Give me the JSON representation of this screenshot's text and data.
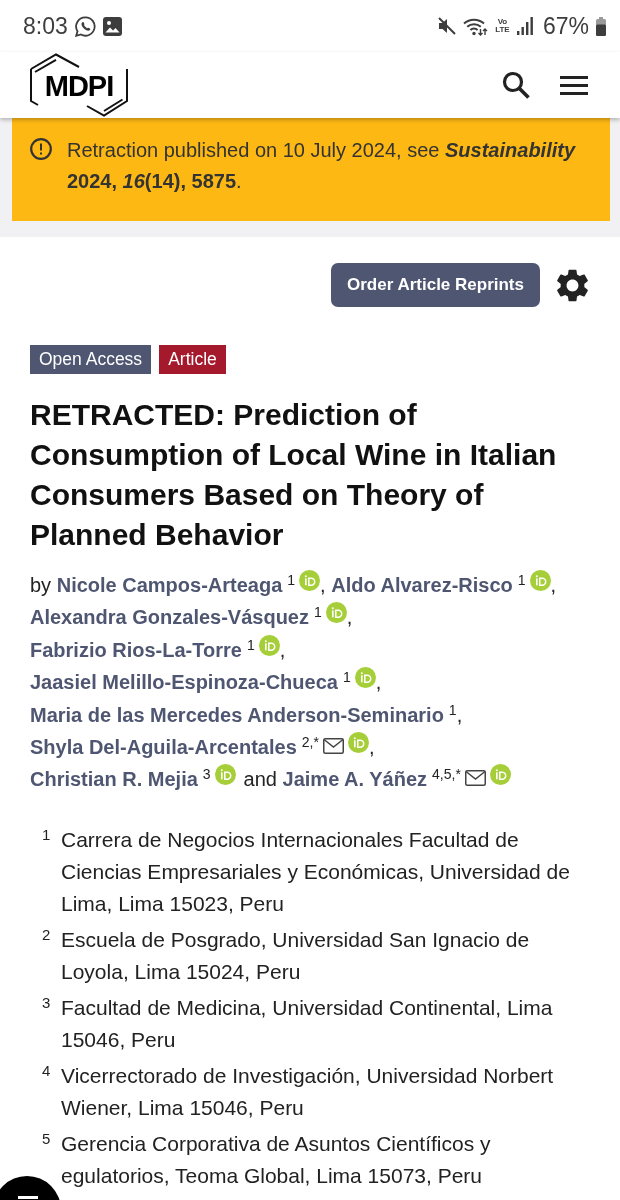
{
  "status_bar": {
    "time": "8:03",
    "network": "Vo LTE",
    "battery": "67%"
  },
  "header": {
    "logo": "MDPI"
  },
  "notice": {
    "text": "Retraction published on 10 July 2024, see ***Sustainability* 2024, *16*(14), 5875**."
  },
  "actions": {
    "button": "Order Article Reprints"
  },
  "badges": [
    {
      "label": "Open Access",
      "color": "#4f5671"
    },
    {
      "label": "Article",
      "color": "#a5192d"
    }
  ],
  "title": "RETRACTED: Prediction of Consumption of Local Wine in Italian Consumers Based on Theory of Planned Behavior",
  "byline": {
    "prefix": "by",
    "authors": [
      {
        "name": "Nicole Campos-Arteaga",
        "affiliations": "1",
        "email": false,
        "orcid": true,
        "after": ","
      },
      {
        "name": "Aldo Alvarez-Risco",
        "affiliations": "1",
        "email": false,
        "orcid": true,
        "after": ","
      },
      {
        "name": "Alexandra Gonzales-Vásquez",
        "affiliations": "1",
        "email": false,
        "orcid": true,
        "after": ","
      },
      {
        "name": "Fabrizio Rios-La-Torre",
        "affiliations": "1",
        "email": false,
        "orcid": true,
        "after": ","
      },
      {
        "name": "Jaasiel Melillo-Espinoza-Chueca",
        "affiliations": "1",
        "email": false,
        "orcid": true,
        "after": ","
      },
      {
        "name": "Maria de las Mercedes Anderson-Seminario",
        "affiliations": "1",
        "email": false,
        "orcid": false,
        "after": ","
      },
      {
        "name": "Shyla Del-Aguila-Arcentales",
        "affiliations": "2,*",
        "email": true,
        "orcid": true,
        "after": ","
      },
      {
        "name": "Christian R. Mejia",
        "affiliations": "3",
        "email": false,
        "orcid": true,
        "after": "and"
      },
      {
        "name": "Jaime A. Yáñez",
        "affiliations": "4,5,*",
        "email": true,
        "orcid": true
      }
    ]
  },
  "affiliations": [
    {
      "number": "1",
      "text": "Carrera de Negocios Internacionales Facultad de Ciencias Empresariales y Económicas, Universidad de Lima, Lima 15023, Peru"
    },
    {
      "number": "2",
      "text": "Escuela de Posgrado, Universidad San Ignacio de Loyola, Lima 15024, Peru"
    },
    {
      "number": "3",
      "text": "Facultad de Medicina, Universidad Continental, Lima 15046, Peru"
    },
    {
      "number": "4",
      "text": "Vicerrectorado de Investigación, Universidad Norbert Wiener, Lima 15046, Peru"
    },
    {
      "number": "5",
      "text": "Gerencia Corporativa de Asuntos Científicos y egulatorios, Teoma Global, Lima 15073, Peru"
    }
  ]
}
